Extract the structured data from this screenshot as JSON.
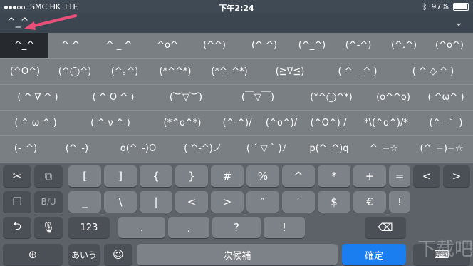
{
  "status": {
    "carrier": "SMC HK",
    "network": "LTE",
    "time": "下午2:24",
    "battery": "97%",
    "battery_level": 0.97
  },
  "input": {
    "text": "^_^"
  },
  "candidates": [
    [
      "^_^",
      "^ ^",
      "^ _ ^",
      "^o^",
      "(^^)",
      "(^ ^)",
      "(^_^)",
      "(^-^)",
      "(^.^)",
      "(^o^)"
    ],
    [
      "(^O^)",
      "(^◯^)",
      "(^｡^)",
      "(*^^*)",
      "(*^_^*)",
      "(≧∇≦)",
      "( ^ _ ^ )",
      "( ^ ◇ ^ )"
    ],
    [
      "( ^ ∇ ^ )",
      "( ^ O ^ )",
      "(︶▽︶)",
      "(￣▽￣)",
      "(*^◯^*)",
      "(o^^o)",
      "( ^ω^ )"
    ],
    [
      "( ^ ω ^ )",
      "( ^ ν ^ )",
      "(*^o^*)",
      "(^-^)/",
      "(^o^)/",
      "(^O^) /",
      "*\\(^o^)/*",
      "(^―゜)"
    ],
    [
      "(-_^)",
      "(^_-)",
      "o(^_-)O",
      "( ^-^)ノ",
      "( ´ ▽ ` )ﾉ",
      "p(^_^)q",
      "^_−☆",
      "(^_−)−☆"
    ]
  ],
  "keys": {
    "row1": [
      "[",
      "]",
      "{",
      "}",
      "#",
      "%",
      "^",
      "*",
      "+",
      "="
    ],
    "row2": [
      "_",
      "\\",
      "|",
      "<",
      ">",
      "″",
      "′",
      "$",
      "€",
      "!"
    ],
    "row3": [
      "123",
      ".",
      ",",
      "?",
      "!"
    ],
    "bottom": {
      "kana": "あいう",
      "space": "次候補",
      "confirm": "確定"
    }
  },
  "icons": {
    "scissors": "✂",
    "copy": "⧉",
    "paste": "❐",
    "biu": "B/U",
    "undo": "⮌",
    "mic": "🎙",
    "emoji": "☺",
    "globe": "⊕",
    "backspace": "⌫",
    "keyboard": "⌨"
  },
  "colors": {
    "accent": "#1a7ef0",
    "arrow": "#e8507a"
  },
  "watermark": "下载吧"
}
